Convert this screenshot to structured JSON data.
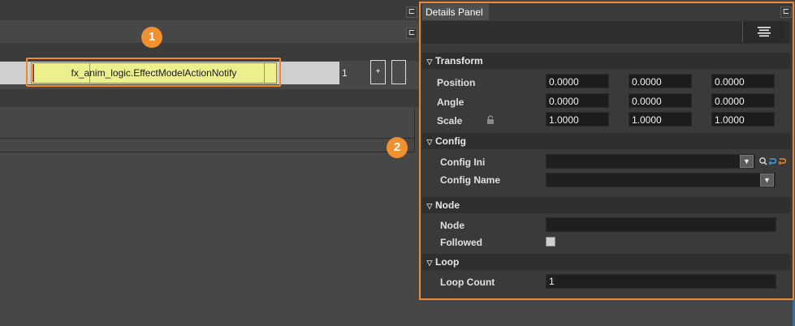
{
  "left": {
    "callout_1": "1",
    "clip_label": "fx_anim_logic.EffectModelActionNotify",
    "track_index": "1",
    "add_button": "+"
  },
  "callout_2": "2",
  "panel": {
    "title": "Details Panel",
    "sections": {
      "transform": {
        "label": "Transform",
        "position_label": "Position",
        "position": [
          "0.0000",
          "0.0000",
          "0.0000"
        ],
        "angle_label": "Angle",
        "angle": [
          "0.0000",
          "0.0000",
          "0.0000"
        ],
        "scale_label": "Scale",
        "scale": [
          "1.0000",
          "1.0000",
          "1.0000"
        ]
      },
      "config": {
        "label": "Config",
        "config_ini_label": "Config Ini",
        "config_ini_value": "",
        "config_name_label": "Config Name",
        "config_name_value": ""
      },
      "node": {
        "label": "Node",
        "node_label": "Node",
        "node_value": "",
        "followed_label": "Followed",
        "followed_checked": false
      },
      "loop": {
        "label": "Loop",
        "loop_count_label": "Loop Count",
        "loop_count_value": "1"
      }
    }
  },
  "icons": [
    "pin-icon",
    "menu-lines-icon",
    "lock-icon",
    "chevron-down-icon",
    "search-icon",
    "refresh-icon",
    "reset-icon"
  ],
  "colors": {
    "accent": "#ef8a30",
    "clip": "#ecef8d",
    "clip_marker": "#c0262b"
  }
}
